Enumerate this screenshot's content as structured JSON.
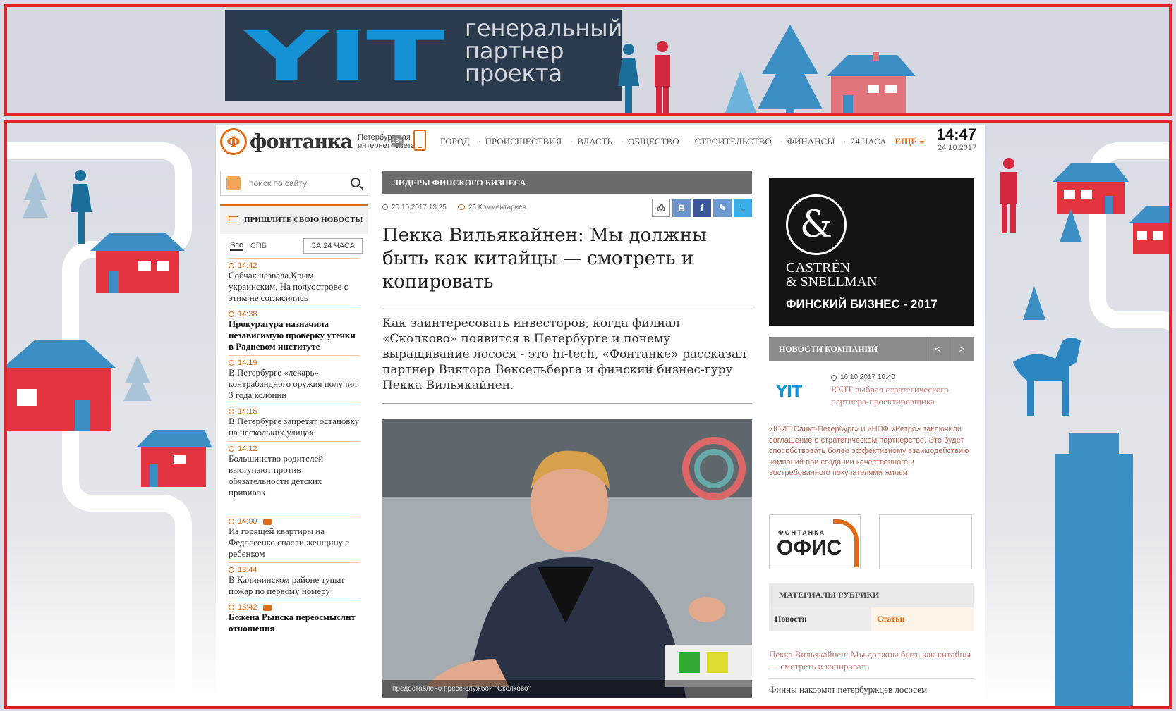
{
  "banner": {
    "logo_text": "YIT",
    "partner_text": "генеральный партнер проекта"
  },
  "header": {
    "logo_name": "фонтанка",
    "logo_sub_line1": "Петербургская",
    "logo_sub_line2": "интернет-газета",
    "age_badge": "18+",
    "nav": [
      "ГОРОД",
      "ПРОИСШЕСТВИЯ",
      "ВЛАСТЬ",
      "ОБЩЕСТВО",
      "СТРОИТЕЛЬСТВО",
      "ФИНАНСЫ",
      "24 ЧАСА"
    ],
    "more_label": "ЕЩЕ ≡",
    "time": "14:47",
    "date": "24.10.2017"
  },
  "left": {
    "search_placeholder": "поиск по сайту",
    "send_news_label": "ПРИШЛИТЕ СВОЮ НОВОСТЬ!",
    "tab_all": "Все",
    "tab_spb": "СПБ",
    "tab_24h": "ЗА 24 ЧАСА",
    "news": [
      {
        "time": "14:42",
        "title": "Собчак назвала Крым украинским. На полуострове с этим не согласились",
        "bold": false,
        "photo": false
      },
      {
        "time": "14:38",
        "title": "Прокуратура назначила независимую проверку утечки в Радиевом институте",
        "bold": true,
        "photo": false
      },
      {
        "time": "14:19",
        "title": "В Петербурге «лекарь» контрабандного оружия получил 3 года колонии",
        "bold": false,
        "photo": false
      },
      {
        "time": "14:15",
        "title": "В Петербурге запретят остановку на нескольких улицах",
        "bold": false,
        "photo": false
      },
      {
        "time": "14:12",
        "title": "Большинство родителей выступают против обязательности детских прививок",
        "bold": false,
        "photo": false
      },
      {
        "time": "14:00",
        "title": "Из горящей квартиры на Федосеенко спасли женщину с ребенком",
        "bold": false,
        "photo": true
      },
      {
        "time": "13:44",
        "title": "В Калининском районе тушат пожар по первому номеру",
        "bold": false,
        "photo": false
      },
      {
        "time": "13:42",
        "title": "Божена Рынска переосмыслит отношения",
        "bold": true,
        "photo": true
      }
    ]
  },
  "article": {
    "rubric": "ЛИДЕРЫ ФИНСКОГО БИЗНЕСА",
    "datetime": "20.10.2017 13:25",
    "comments": "26 Комментариев",
    "title": "Пекка Вильякайнен: Мы должны быть как китайцы — смотреть и копировать",
    "lead": "Как заинтересовать инвесторов, когда филиал «Сколково» появится в Петербурге и почему выращивание лосося - это hi-tech, «Фонтанке» рассказал партнер Виктора Вексельберга и финский бизнес-гуру Пекка Вильякайнен.",
    "photo_caption": "предоставлено пресс-службой \"Сколково\""
  },
  "right": {
    "ad_line1": "CASTRÉN",
    "ad_line2": "& SNELLMAN",
    "ad_year": "ФИНСКИЙ БИЗНЕС - 2017",
    "company_news_title": "НОВОСТИ КОМПАНИЙ",
    "prev": "<",
    "next": ">",
    "cn_logo": "YIT",
    "cn_date": "16.10.2017 16:40",
    "cn_headline": "ЮИТ выбрал стратегического партнера-проектировщика",
    "cn_body": "«ЮИТ Санкт-Петербург» и «НПФ «Ретро» заключили соглашение о стратегическом партнерстве. Это будет способствовать более эффективному взаимодействию компаний при создании качественного и востребованного покупателями жилья",
    "office_small": "ФОНТАНКА",
    "office_big": "ОФИС",
    "rubric_materials": "МАТЕРИАЛЫ РУБРИКИ",
    "rtab_news": "Новости",
    "rtab_articles": "Статьи",
    "rubric_link1": "Пекка Вильякайнен: Мы должны быть как китайцы — смотреть и копировать",
    "rubric_link2": "Финны накормят петербуржцев лососем"
  },
  "colors": {
    "accent": "#e06a16",
    "frame": "#e3242b",
    "yit_blue": "#1591d6",
    "arrow": "#f5b800"
  }
}
